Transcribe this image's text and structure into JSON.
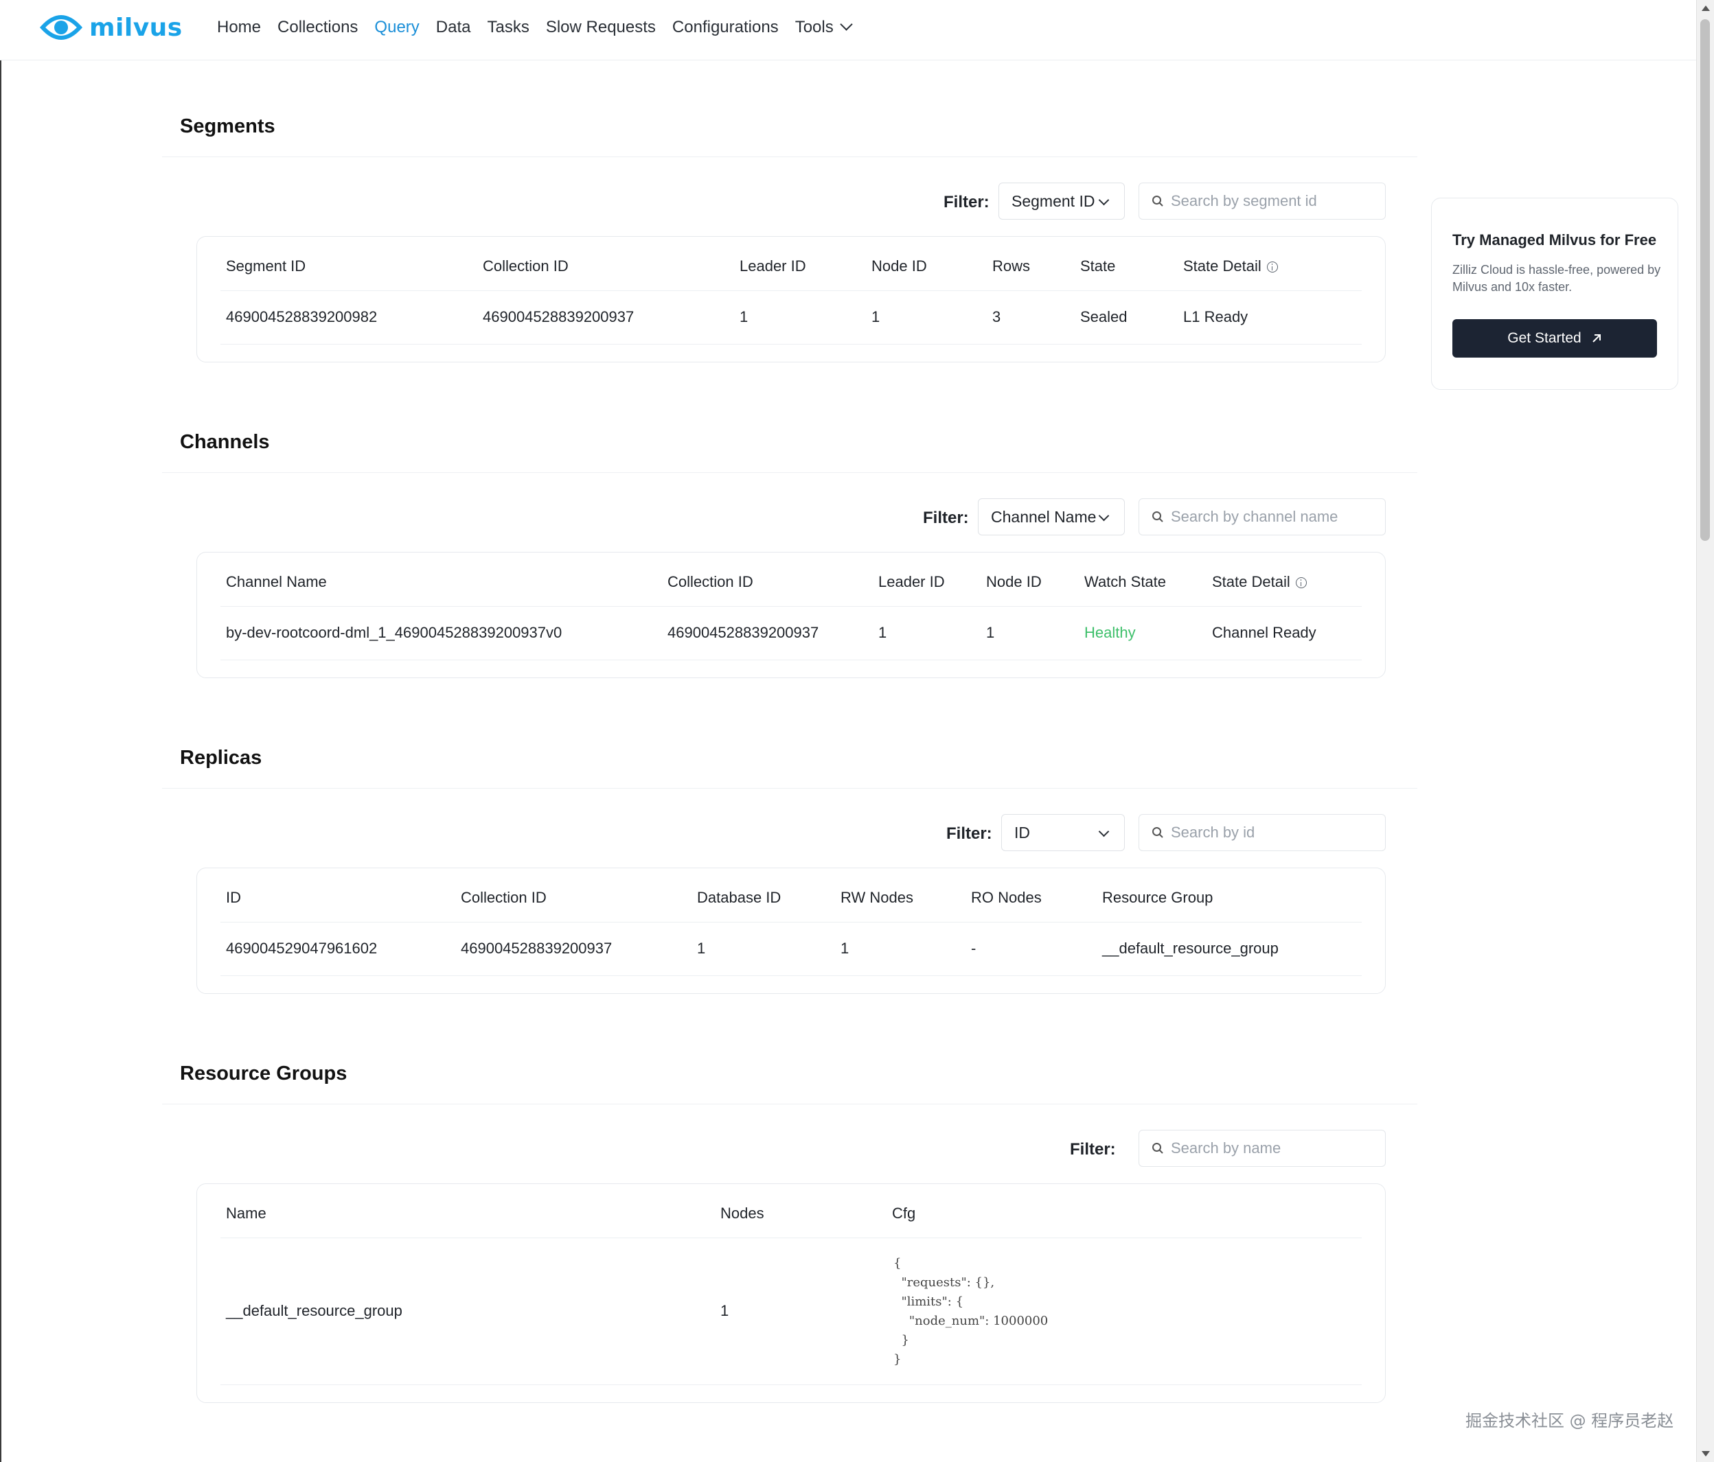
{
  "nav": {
    "logo_text": "milvus",
    "items": [
      {
        "label": "Home"
      },
      {
        "label": "Collections"
      },
      {
        "label": "Query",
        "active": true
      },
      {
        "label": "Data"
      },
      {
        "label": "Tasks"
      },
      {
        "label": "Slow Requests"
      },
      {
        "label": "Configurations"
      },
      {
        "label": "Tools",
        "has_dropdown": true
      }
    ]
  },
  "segments": {
    "title": "Segments",
    "filter_label": "Filter:",
    "filter_value": "Segment ID",
    "search_placeholder": "Search by segment id",
    "columns": [
      "Segment ID",
      "Collection ID",
      "Leader ID",
      "Node ID",
      "Rows",
      "State",
      "State Detail"
    ],
    "rows": [
      [
        "469004528839200982",
        "469004528839200937",
        "1",
        "1",
        "3",
        "Sealed",
        "L1 Ready"
      ]
    ]
  },
  "channels": {
    "title": "Channels",
    "filter_label": "Filter:",
    "filter_value": "Channel Name",
    "search_placeholder": "Search by channel name",
    "columns": [
      "Channel Name",
      "Collection ID",
      "Leader ID",
      "Node ID",
      "Watch State",
      "State Detail"
    ],
    "rows": [
      [
        "by-dev-rootcoord-dml_1_469004528839200937v0",
        "469004528839200937",
        "1",
        "1",
        "Healthy",
        "Channel Ready"
      ]
    ]
  },
  "replicas": {
    "title": "Replicas",
    "filter_label": "Filter:",
    "filter_value": "ID",
    "search_placeholder": "Search by id",
    "columns": [
      "ID",
      "Collection ID",
      "Database ID",
      "RW Nodes",
      "RO Nodes",
      "Resource Group"
    ],
    "rows": [
      [
        "469004529047961602",
        "469004528839200937",
        "1",
        "1",
        "-",
        "__default_resource_group"
      ]
    ]
  },
  "resource_groups": {
    "title": "Resource Groups",
    "filter_label": "Filter:",
    "search_placeholder": "Search by name",
    "columns": [
      "Name",
      "Nodes",
      "Cfg"
    ],
    "rows": [
      {
        "name": "__default_resource_group",
        "nodes": "1",
        "cfg": "{\n  \"requests\": {},\n  \"limits\": {\n    \"node_num\": 1000000\n  }\n}"
      }
    ]
  },
  "promo": {
    "title": "Try Managed Milvus for Free",
    "text": "Zilliz Cloud is hassle-free, powered by Milvus and 10x faster.",
    "button": "Get Started"
  },
  "footer_mark": "掘金技术社区 @ 程序员老赵",
  "colors": {
    "accent": "#1b8fd8",
    "logo": "#1aa3e8",
    "healthy": "#3dbf6a",
    "promo_button": "#1c2433"
  }
}
